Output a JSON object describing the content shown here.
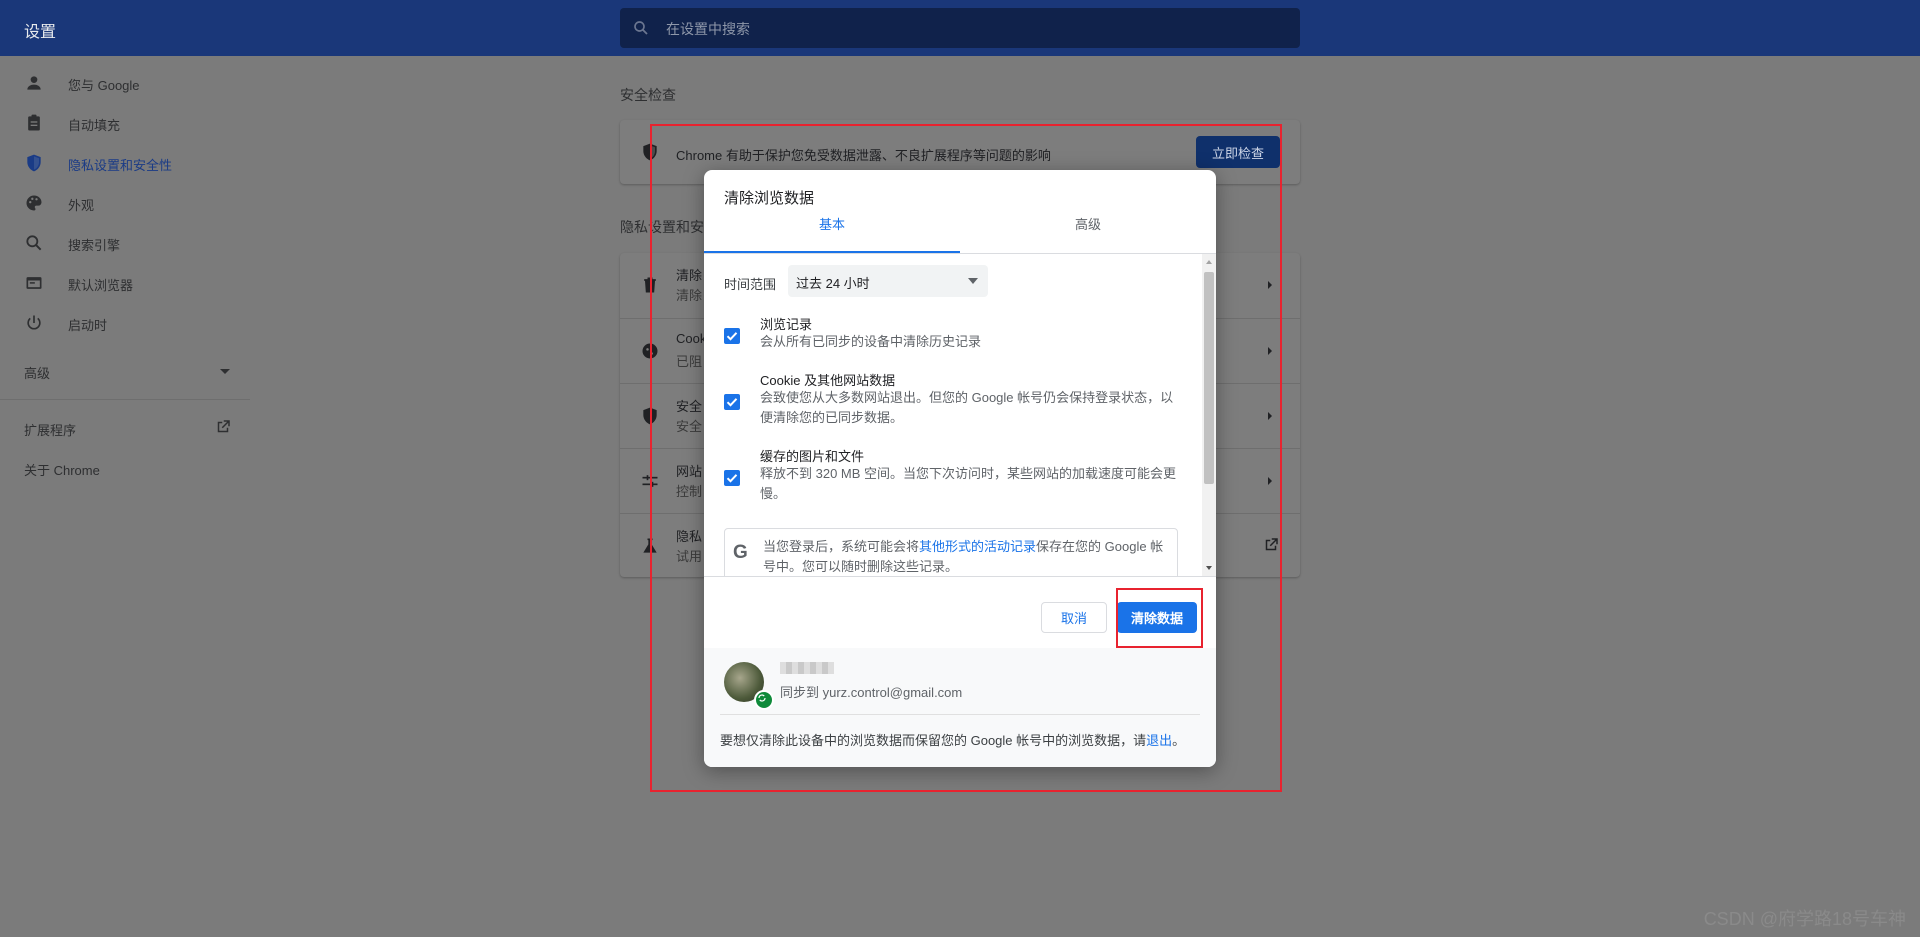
{
  "header": {
    "title": "设置",
    "search_placeholder": "在设置中搜索"
  },
  "sidebar": {
    "items": [
      {
        "label": "您与 Google",
        "icon": "person-icon"
      },
      {
        "label": "自动填充",
        "icon": "clipboard-icon"
      },
      {
        "label": "隐私设置和安全性",
        "icon": "shield-icon"
      },
      {
        "label": "外观",
        "icon": "palette-icon"
      },
      {
        "label": "搜索引擎",
        "icon": "search-icon"
      },
      {
        "label": "默认浏览器",
        "icon": "browser-icon"
      },
      {
        "label": "启动时",
        "icon": "power-icon"
      }
    ],
    "advanced": "高级",
    "extensions": "扩展程序",
    "about": "关于 Chrome"
  },
  "main": {
    "safety_title": "安全检查",
    "safety_text": "Chrome 有助于保护您免受数据泄露、不良扩展程序等问题的影响",
    "safety_button": "立即检查",
    "privacy_title": "隐私设置和安",
    "rows": [
      {
        "t1": "清除",
        "t2": "清除"
      },
      {
        "t1": "Cook",
        "t2": "已阻"
      },
      {
        "t1": "安全",
        "t2": "安全"
      },
      {
        "t1": "网站",
        "t2": "控制"
      },
      {
        "t1": "隐私",
        "t2": "试用"
      }
    ]
  },
  "dialog": {
    "title": "清除浏览数据",
    "tabs": [
      "基本",
      "高级"
    ],
    "time_range_label": "时间范围",
    "time_range_value": "过去 24 小时",
    "options": [
      {
        "title": "浏览记录",
        "desc": "会从所有已同步的设备中清除历史记录",
        "checked": true
      },
      {
        "title": "Cookie 及其他网站数据",
        "desc": "会致使您从大多数网站退出。但您的 Google 帐号仍会保持登录状态，以便清除您的已同步数据。",
        "checked": true
      },
      {
        "title": "缓存的图片和文件",
        "desc": "释放不到 320 MB 空间。当您下次访问时，某些网站的加载速度可能会更慢。",
        "checked": true
      }
    ],
    "google_note_prefix": "当您登录后，系统可能会将",
    "google_note_link": "其他形式的活动记录",
    "google_note_suffix": "保存在您的 Google 帐号中。您可以随时删除这些记录。",
    "cancel": "取消",
    "clear": "清除数据",
    "account_email": "同步到 yurz.control@gmail.com",
    "footer_prefix": "要想仅清除此设备中的浏览数据而保留您的 Google 帐号中的浏览数据，请",
    "footer_link": "退出",
    "footer_suffix": "。"
  },
  "watermark": "CSDN @府学路18号车神",
  "colors": {
    "accent": "#1a73e8",
    "header": "#1a3779",
    "annotation": "#e8232f"
  }
}
